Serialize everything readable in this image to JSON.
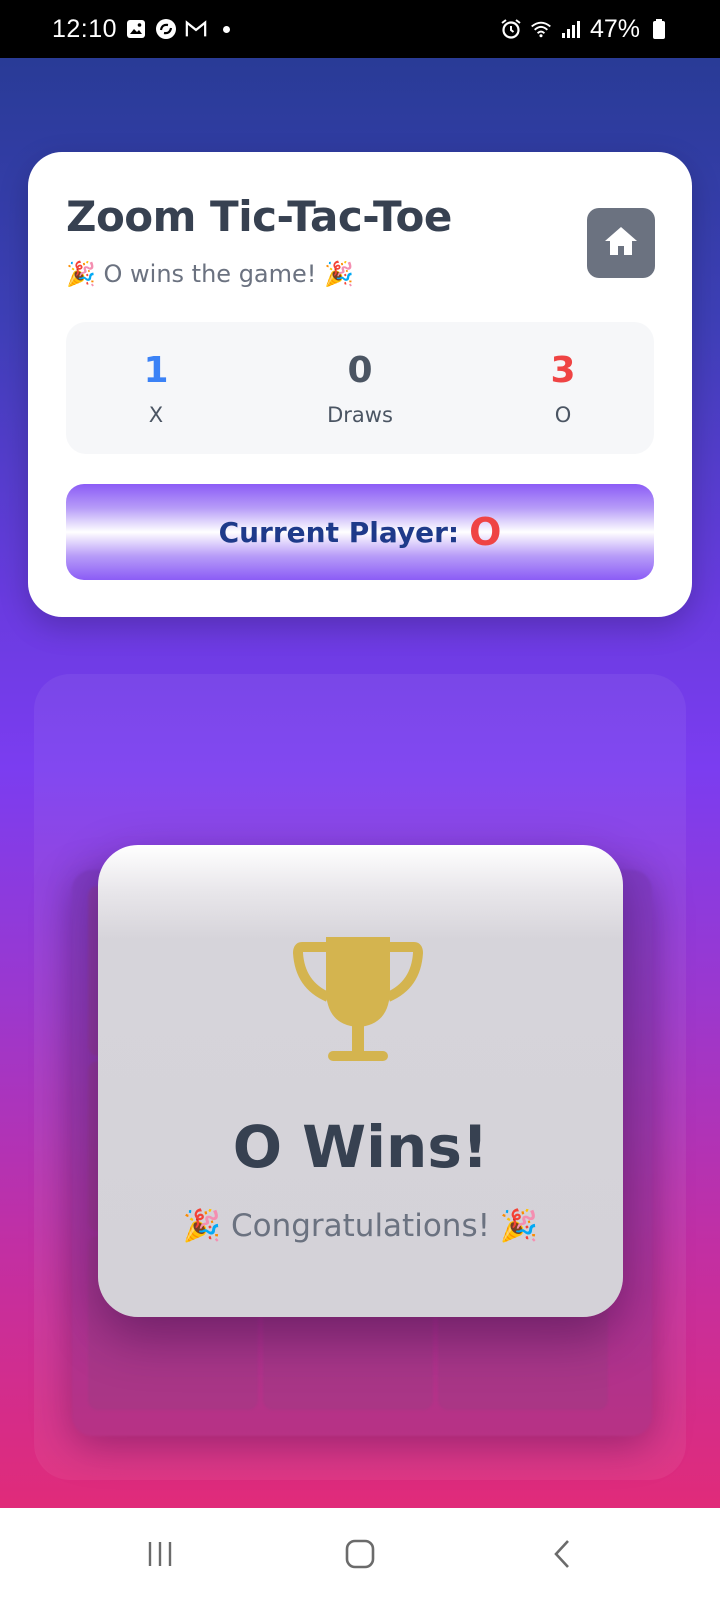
{
  "status_bar": {
    "time": "12:10",
    "battery": "47%",
    "icons": [
      "image-icon",
      "sync-icon",
      "gmail-icon",
      "dot-icon",
      "alarm-icon",
      "wifi-icon",
      "signal-icon",
      "battery-icon"
    ]
  },
  "header": {
    "title": "Zoom Tic-Tac-Toe",
    "status": "🎉 O wins the game! 🎉",
    "home_icon": "home-icon"
  },
  "scores": {
    "x": {
      "value": "1",
      "label": "X"
    },
    "draws": {
      "value": "0",
      "label": "Draws"
    },
    "o": {
      "value": "3",
      "label": "O"
    }
  },
  "current_player": {
    "label": "Current Player:",
    "value": "O"
  },
  "modal": {
    "icon": "trophy-icon",
    "title": "O Wins!",
    "subtitle": "🎉 Congratulations! 🎉"
  },
  "colors": {
    "x_color": "#3b82f6",
    "o_color": "#ef4444",
    "trophy_color": "#d4b44f",
    "title_color": "#374151"
  },
  "nav": {
    "items": [
      "recent-apps-icon",
      "home-nav-icon",
      "back-icon"
    ]
  }
}
